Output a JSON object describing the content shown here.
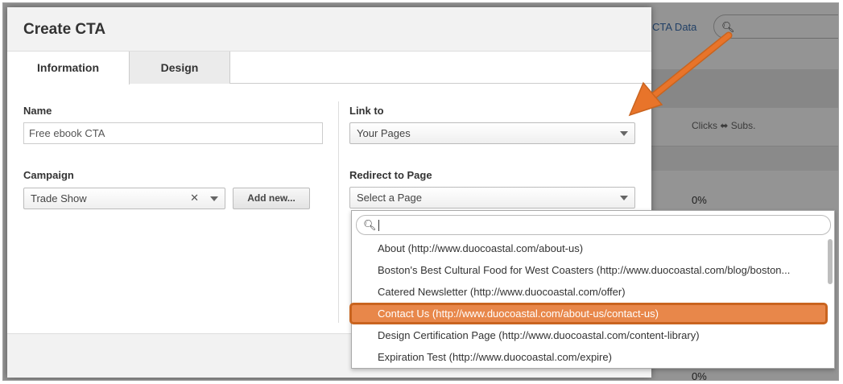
{
  "background": {
    "link_text": "CTA Data",
    "clicks_header": "Clicks ⬌ Subs.",
    "pct_values": [
      "0%",
      "0%"
    ]
  },
  "modal": {
    "title": "Create CTA",
    "tabs": [
      {
        "label": "Information",
        "active": true
      },
      {
        "label": "Design",
        "active": false
      }
    ],
    "name_label": "Name",
    "name_value": "Free ebook CTA",
    "campaign_label": "Campaign",
    "campaign_value": "Trade Show",
    "add_new_label": "Add new...",
    "link_to_label": "Link to",
    "link_to_value": "Your Pages",
    "redirect_label": "Redirect to Page",
    "redirect_placeholder": "Select a Page"
  },
  "dropdown": {
    "search_value": "",
    "items": [
      "About (http://www.duocoastal.com/about-us)",
      "Boston's Best Cultural Food for West Coasters (http://www.duocoastal.com/blog/boston...",
      "Catered Newsletter (http://www.duocoastal.com/offer)",
      "Contact Us (http://www.duocoastal.com/about-us/contact-us)",
      "Design Certification Page (http://www.duocoastal.com/content-library)",
      "Expiration Test (http://www.duocoastal.com/expire)"
    ],
    "highlighted_index": 3
  },
  "colors": {
    "highlight": "#e8874a",
    "annotation_arrow": "#e8742a",
    "link": "#3a6fb0"
  },
  "icons": [
    "search-icon",
    "clear-icon",
    "chevron-down-icon",
    "annotation-arrow"
  ]
}
